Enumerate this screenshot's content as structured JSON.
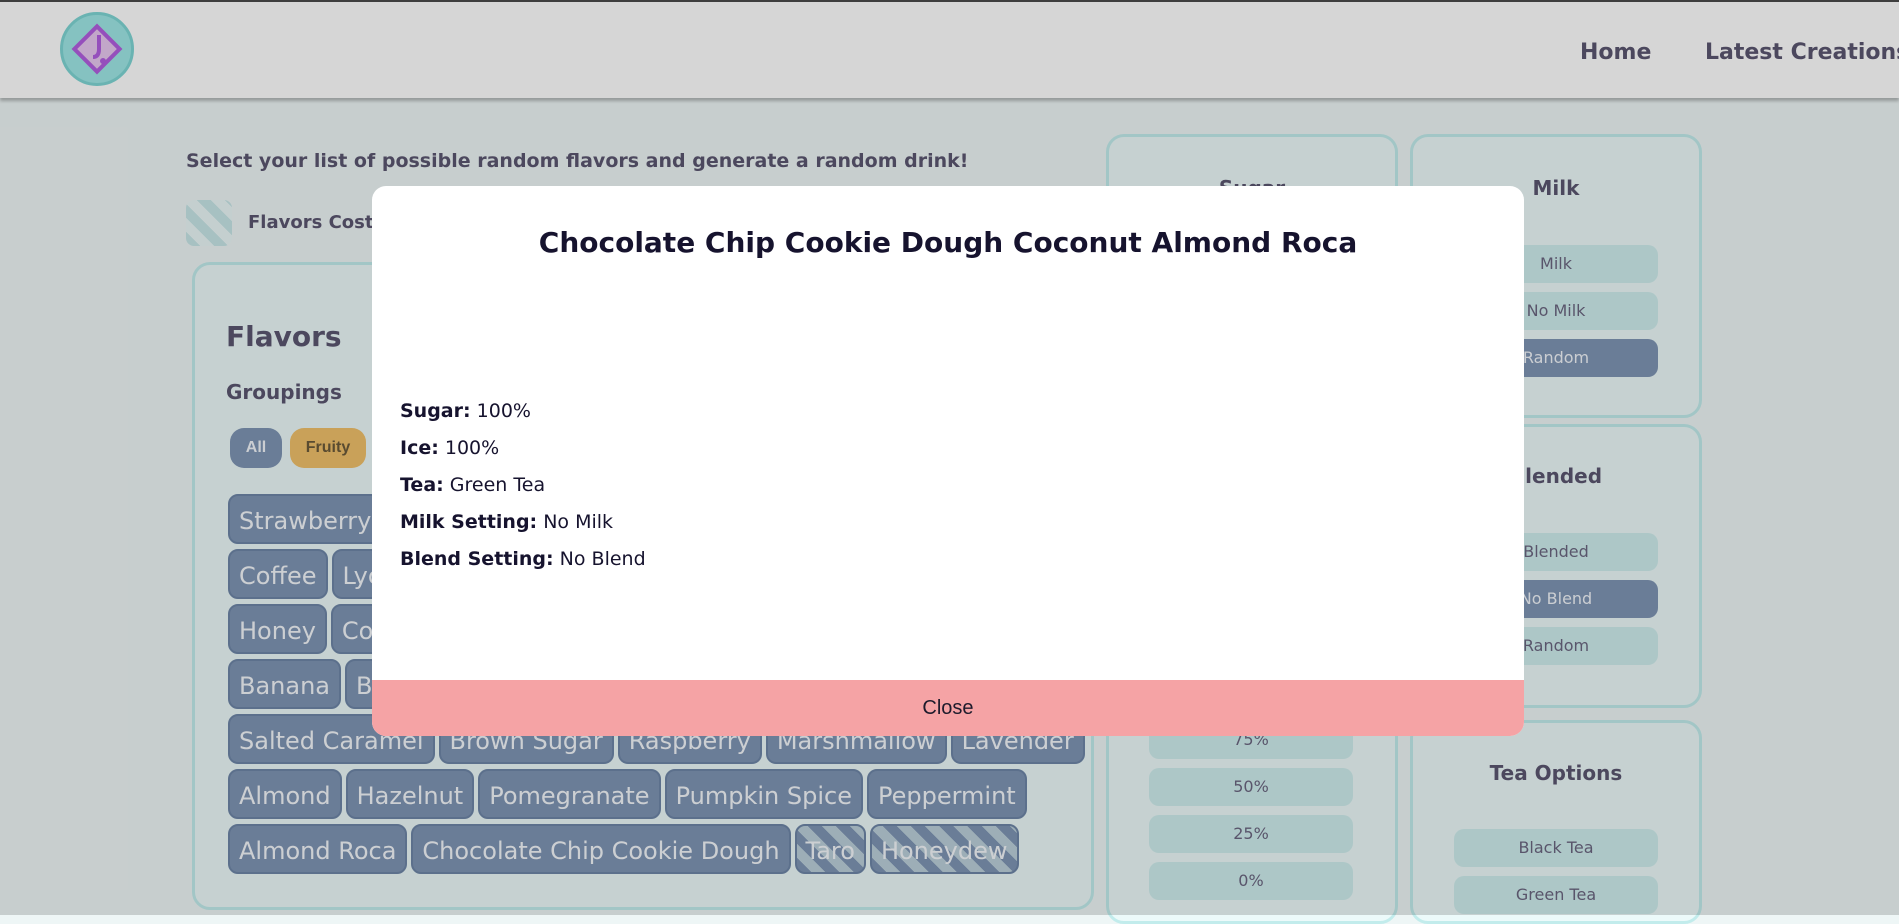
{
  "nav": {
    "home": "Home",
    "latest": "Latest Creations"
  },
  "intro_text": "Select your list of possible random flavors and generate a random drink!",
  "cost_label": "Flavors Cost Ex",
  "flavors": {
    "title": "Flavors",
    "groupings_title": "Groupings",
    "groupings": [
      "All",
      "Fruity"
    ],
    "rows": [
      [
        "Strawberry"
      ],
      [
        "Coffee",
        "Lych"
      ],
      [
        "Honey",
        "Coc"
      ],
      [
        "Banana",
        "But"
      ],
      [
        "Salted Caramel",
        "Brown Sugar",
        "Raspberry",
        "Marshmallow",
        "Lavender"
      ],
      [
        "Almond",
        "Hazelnut",
        "Pomegranate",
        "Pumpkin Spice",
        "Peppermint"
      ],
      [
        "Almond Roca",
        "Chocolate Chip Cookie Dough",
        "Taro",
        "Honeydew"
      ]
    ],
    "unavailable": [
      "Taro",
      "Honeydew"
    ]
  },
  "sugar": {
    "title": "Sugar",
    "options": [
      "75%",
      "50%",
      "25%",
      "0%"
    ]
  },
  "milk": {
    "title": "Milk",
    "options": [
      "Milk",
      "No Milk",
      "Random"
    ],
    "selected": "Random"
  },
  "blended": {
    "title": "Blended",
    "options": [
      "Blended",
      "No Blend",
      "Random"
    ],
    "selected": "No Blend"
  },
  "tea": {
    "title": "Tea Options",
    "options": [
      "Black Tea",
      "Green Tea"
    ]
  },
  "modal": {
    "title": "Chocolate Chip Cookie Dough Coconut Almond Roca",
    "details": [
      {
        "label": "Sugar:",
        "value": "100%"
      },
      {
        "label": "Ice:",
        "value": "100%"
      },
      {
        "label": "Tea:",
        "value": "Green Tea"
      },
      {
        "label": "Milk Setting:",
        "value": "No Milk"
      },
      {
        "label": "Blend Setting:",
        "value": "No Blend"
      }
    ],
    "close_label": "Close"
  },
  "colors": {
    "accent": "#7f95b4",
    "fruity": "#f0c06a",
    "close": "#f5a3a5",
    "panel_border": "#c2ecec"
  }
}
